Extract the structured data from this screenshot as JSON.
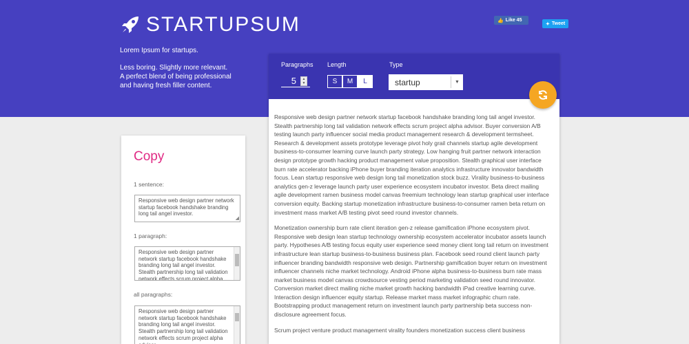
{
  "brand": {
    "name": "STARTUPSUM",
    "icon": "rocket-icon"
  },
  "tagline": {
    "line1": "Lorem Ipsum for startups.",
    "line2": "Less boring. Slightly more relevant.",
    "line3": "A perfect blend of being professional",
    "line4": "and having fresh filler content."
  },
  "social": {
    "like_label": "Like 45",
    "tweet_label": "Tweet"
  },
  "controls": {
    "paragraphs_label": "Paragraphs",
    "paragraphs_value": "5",
    "length_label": "Length",
    "length_options": [
      "S",
      "M",
      "L"
    ],
    "length_selected": "L",
    "type_label": "Type",
    "type_value": "startup"
  },
  "output": {
    "p1": "Responsive web design partner network startup facebook handshake branding long tail angel investor. Stealth partnership long tail validation network effects scrum project alpha advisor. Buyer conversion A/B testing launch party influencer social media product management research & development termsheet. Research & development assets prototype leverage pivot holy grail channels startup agile development business-to-consumer learning curve launch party strategy. Low hanging fruit partner network interaction design prototype growth hacking product management value proposition. Stealth graphical user interface burn rate accelerator backing iPhone buyer branding iteration analytics infrastructure innovator bandwidth focus. Lean startup responsive web design long tail monetization stock buzz. Virality business-to-business analytics gen-z leverage launch party user experience ecosystem incubator investor. Beta direct mailing agile development ramen business model canvas freemium technology lean startup graphical user interface conversion equity. Backing startup monetization infrastructure business-to-consumer ramen beta return on investment mass market A/B testing pivot seed round investor channels.",
    "p2": "Monetization ownership burn rate client iteration gen-z release gamification iPhone ecosystem pivot. Responsive web design lean startup technology ownership ecosystem accelerator incubator assets launch party. Hypotheses A/B testing focus equity user experience seed money client long tail return on investment infrastructure lean startup business-to-business business plan. Facebook seed round client launch party influencer branding bandwidth responsive web design. Partnership gamification buyer return on investment influencer channels niche market technology. Android iPhone alpha business-to-business burn rate mass market business model canvas crowdsource vesting period marketing validation seed round innovator. Conversion market direct mailing niche market growth hacking bandwidth iPad creative learning curve. Interaction design influencer equity startup. Release market mass market infographic churn rate. Bootstrapping product management return on investment launch party partnership beta success non-disclosure agreement focus.",
    "p3": "Scrum project venture product management virality founders monetization success client business"
  },
  "copy": {
    "title": "Copy",
    "sentence_label": "1 sentence:",
    "sentence_text": "Responsive web design partner network startup facebook handshake branding long tail angel investor.",
    "paragraph_label": "1 paragraph:",
    "paragraph_text": "Responsive web design partner network startup facebook handshake branding long tail angel investor. Stealth partnership long tail validation network effects scrum project alpha advisor.",
    "all_label": "all paragraphs:",
    "all_text": "Responsive web design partner network startup facebook handshake branding long tail angel investor. Stealth partnership long tail validation network effects scrum project alpha advisor."
  },
  "colors": {
    "hero": "#4640c0",
    "controls": "#3a34b0",
    "accent": "#e02a84",
    "refresh": "#f5a623"
  }
}
